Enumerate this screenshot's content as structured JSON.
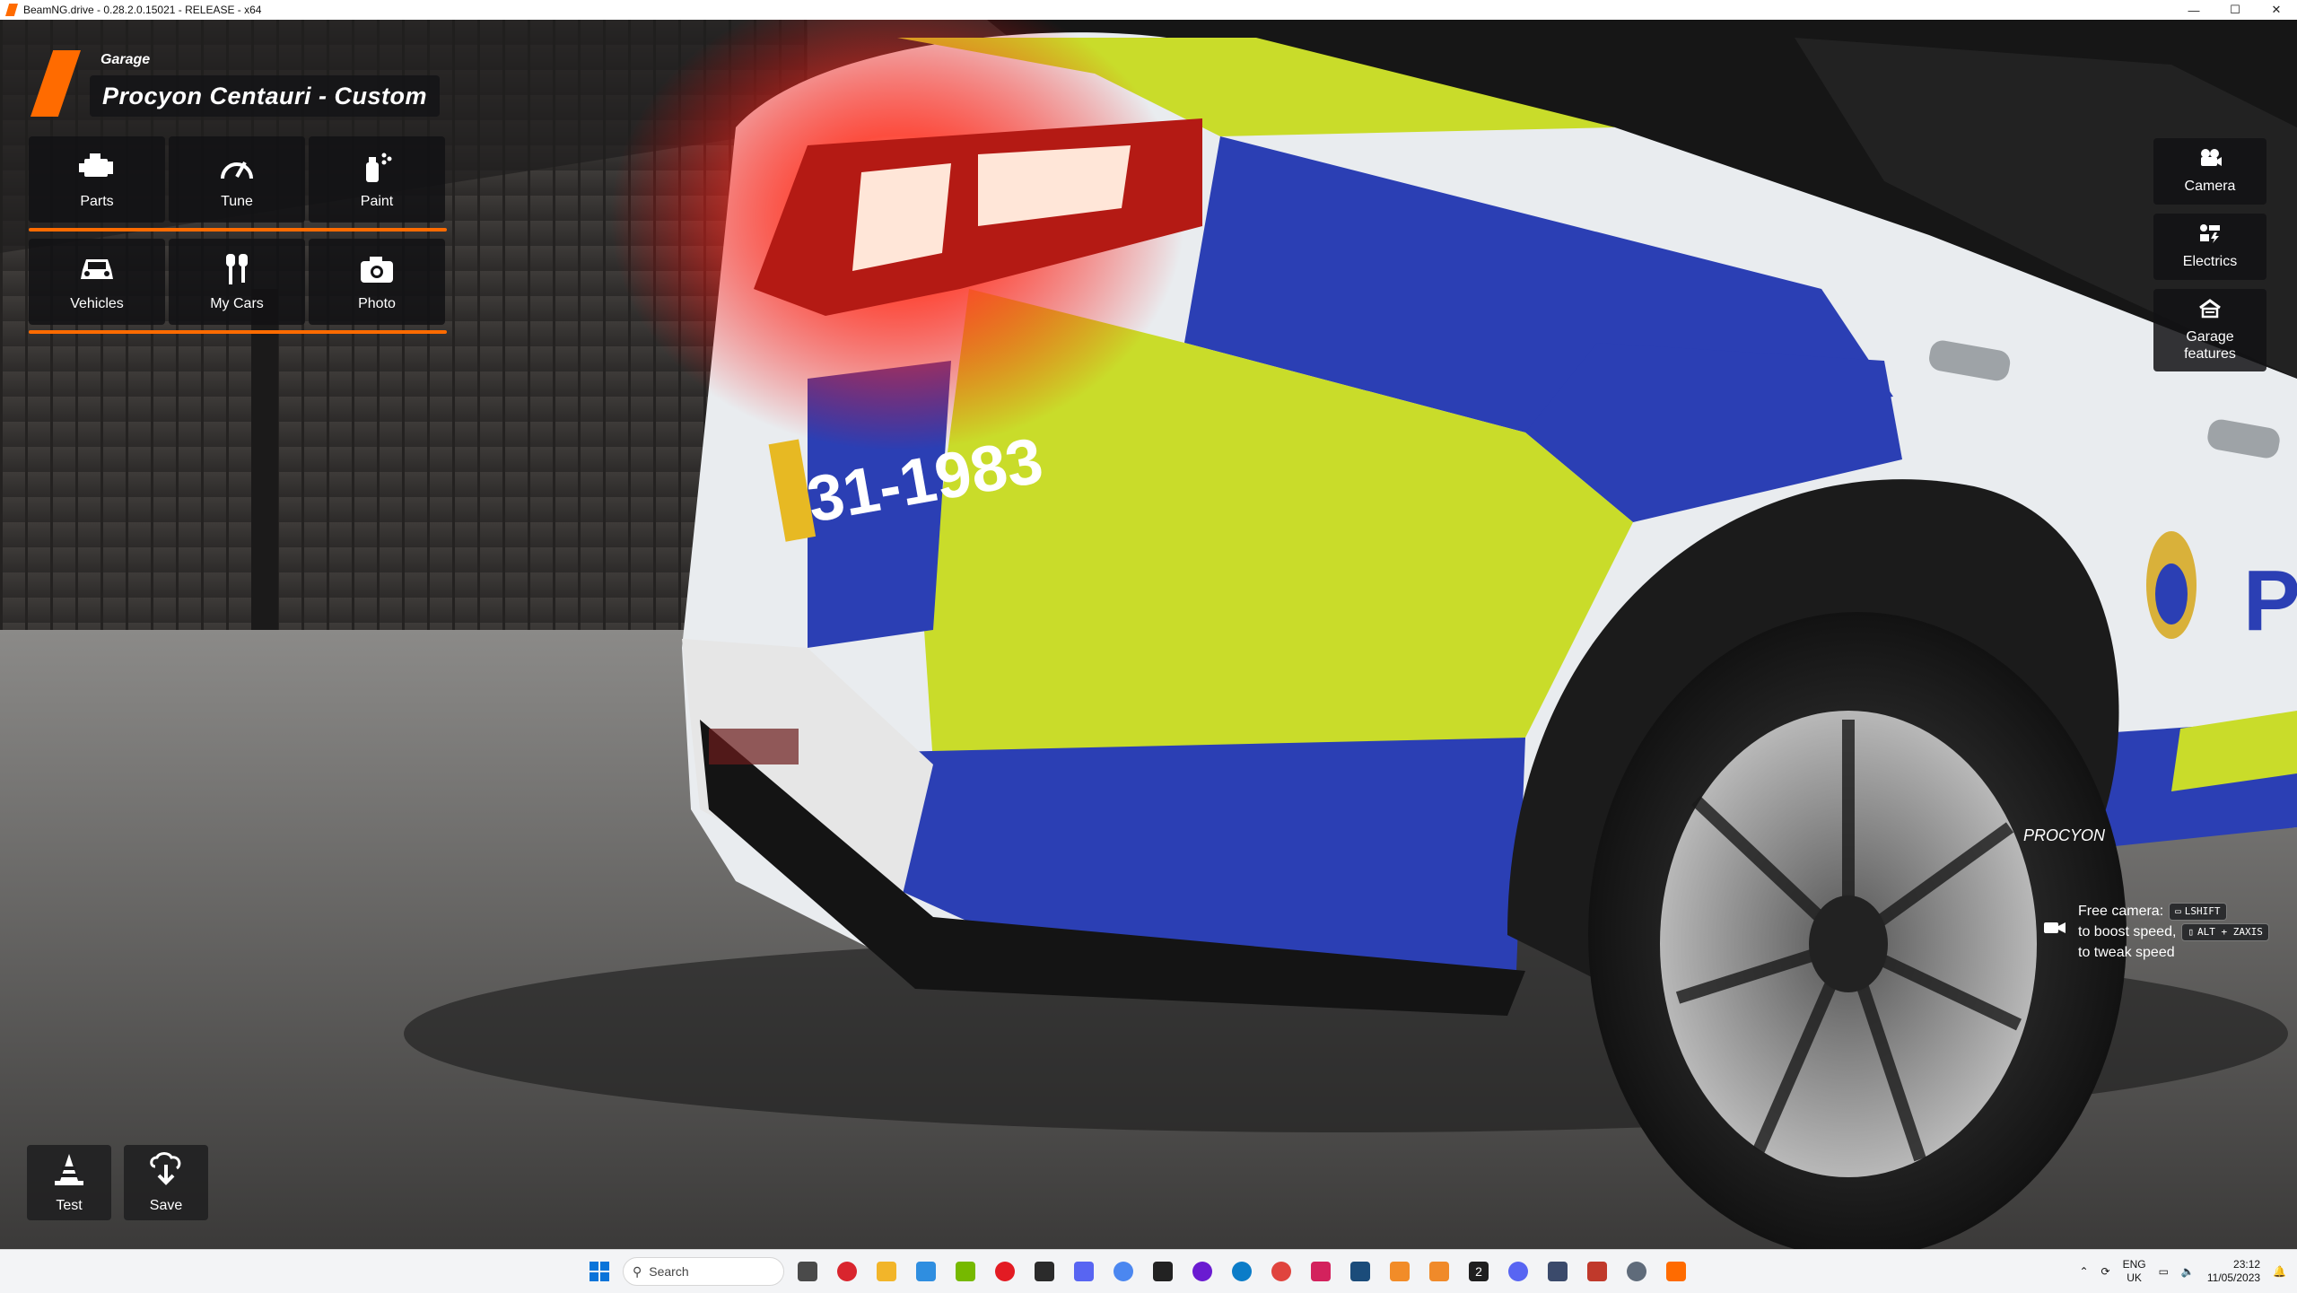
{
  "window": {
    "title": "BeamNG.drive - 0.28.2.0.15021 - RELEASE - x64",
    "controls": [
      "—",
      "☐",
      "✕"
    ]
  },
  "garage": {
    "section_label": "Garage",
    "vehicle_name": "Procyon Centauri - Custom"
  },
  "menu": {
    "parts": "Parts",
    "tune": "Tune",
    "paint": "Paint",
    "vehicles": "Vehicles",
    "my_cars": "My Cars",
    "photo": "Photo"
  },
  "side": {
    "camera": "Camera",
    "electrics": "Electrics",
    "garage_features_line1": "Garage",
    "garage_features_line2": "features"
  },
  "bottom": {
    "test": "Test",
    "save": "Save"
  },
  "camera_hint": {
    "line1": "Free camera:",
    "key1": "LSHIFT",
    "line2": "to boost speed,",
    "key2": "ALT + ZAXIS",
    "line3": "to tweak speed"
  },
  "scene": {
    "plate_text": "31-1983",
    "brand_text": "PROCYON",
    "side_text": "PO",
    "colors": {
      "accent": "#ff6b00",
      "livery_yellow": "#c9dc2a",
      "livery_blue": "#2b3fb4",
      "body_white": "#eceff1"
    }
  },
  "taskbar": {
    "search_placeholder": "Search",
    "lang_line1": "ENG",
    "lang_line2": "UK",
    "time": "23:12",
    "date": "11/05/2023",
    "badge_count": "2"
  }
}
